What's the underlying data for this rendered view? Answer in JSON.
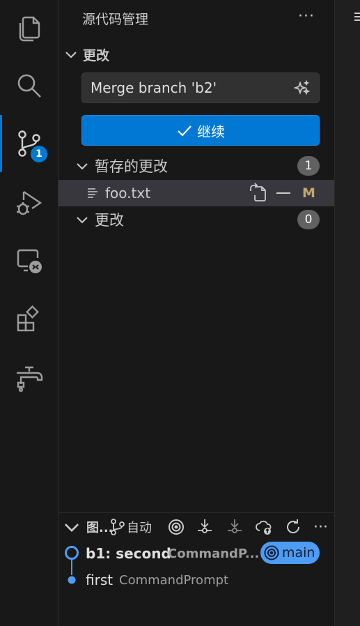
{
  "activity_bar": {
    "items": [
      {
        "name": "explorer",
        "icon": "files-icon"
      },
      {
        "name": "search",
        "icon": "search-icon"
      },
      {
        "name": "source-control",
        "icon": "source-control-icon",
        "badge": "1",
        "active": true
      },
      {
        "name": "run-debug",
        "icon": "run-debug-icon"
      },
      {
        "name": "remote-explorer",
        "icon": "remote-explorer-icon"
      },
      {
        "name": "extensions",
        "icon": "extensions-icon"
      },
      {
        "name": "tap",
        "icon": "faucet-icon"
      }
    ],
    "source_control_badge": "1"
  },
  "panel": {
    "title": "源代码管理",
    "more_label": "···"
  },
  "changes_section": {
    "title": "更改",
    "commit_message": "Merge branch 'b2'",
    "continue_label": "继续"
  },
  "groups": {
    "staged": {
      "label": "暂存的更改",
      "count": "1"
    },
    "changes": {
      "label": "更改",
      "count": "0"
    }
  },
  "staged_files": [
    {
      "name": "foo.txt",
      "status": "M"
    }
  ],
  "graph": {
    "title": "图...",
    "auto_label": "自动",
    "more_label": "···",
    "commits": [
      {
        "title": "b1: second",
        "author": "CommandP...",
        "branch": "main"
      },
      {
        "title": "first",
        "author": "CommandPrompt"
      }
    ]
  },
  "colors": {
    "accent": "#0078d4",
    "modified": "#c4a66d",
    "branch_pill": "#4d9cf5",
    "graph_line": "#4d9cf5"
  }
}
